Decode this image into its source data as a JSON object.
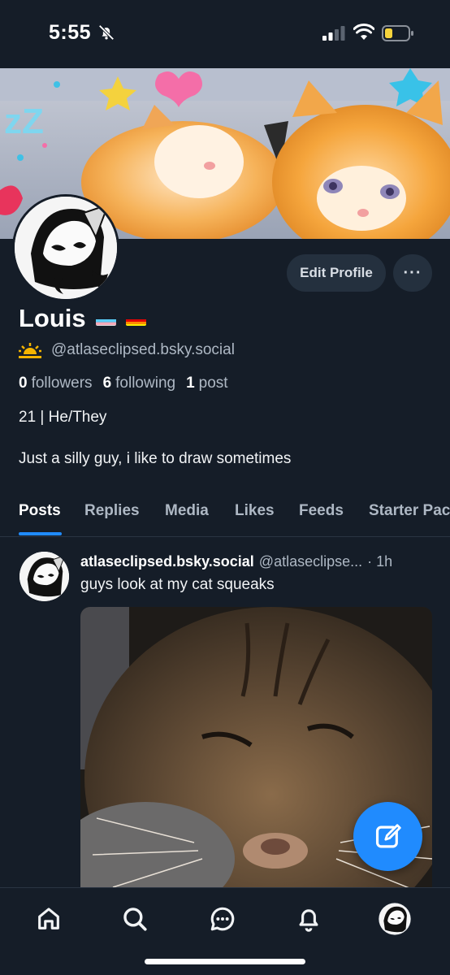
{
  "status_bar": {
    "time": "5:55",
    "icons": [
      "bell-off-icon",
      "signal-icon",
      "wifi-icon",
      "battery-icon"
    ],
    "battery_level": 0.3
  },
  "profile": {
    "display_name": "Louis",
    "name_emojis": [
      "transgender-flag",
      "rainbow-flag"
    ],
    "handle": "@atlaseclipsed.bsky.social",
    "handle_icon": "sunrise-icon",
    "followers_count": "0",
    "followers_label": "followers",
    "following_count": "6",
    "following_label": "following",
    "posts_count": "1",
    "posts_label": "post",
    "bio_line1": "21 | He/They",
    "bio_line2": "Just a silly guy, i like to draw sometimes",
    "edit_label": "Edit Profile",
    "more_label": "···"
  },
  "tabs": [
    {
      "label": "Posts",
      "active": true
    },
    {
      "label": "Replies",
      "active": false
    },
    {
      "label": "Media",
      "active": false
    },
    {
      "label": "Likes",
      "active": false
    },
    {
      "label": "Feeds",
      "active": false
    },
    {
      "label": "Starter Packs",
      "active": false
    }
  ],
  "post": {
    "author": "atlaseclipsed.bsky.social",
    "handle": "@atlaseclipse...",
    "time": "· 1h",
    "text": "guys look at my cat squeaks"
  },
  "nav": [
    "home-icon",
    "search-icon",
    "chat-icon",
    "bell-icon",
    "profile-avatar"
  ],
  "colors": {
    "background": "#151d28",
    "accent": "#208bfe",
    "button_bg": "#24303e",
    "muted_text": "#aeb8c4"
  }
}
